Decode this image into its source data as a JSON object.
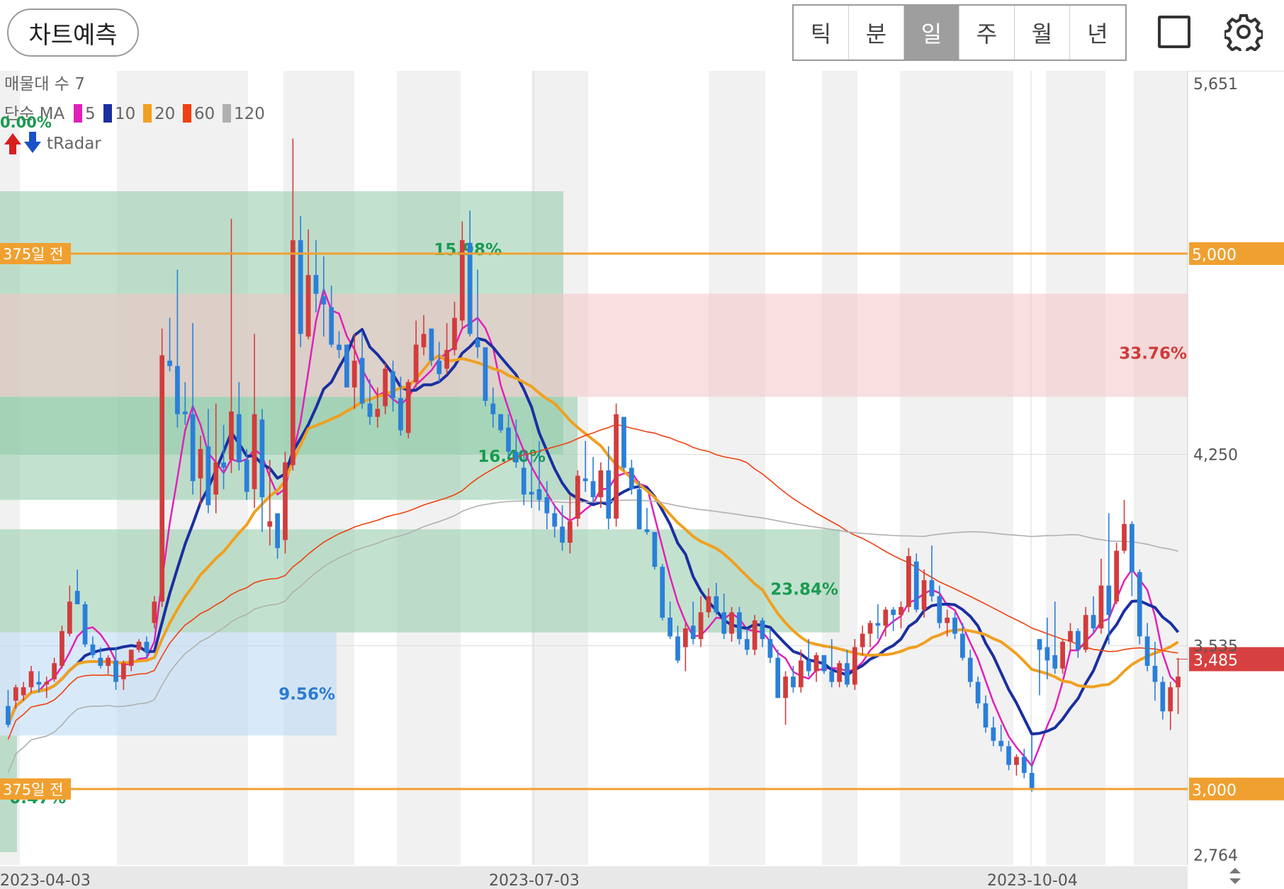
{
  "header": {
    "predict_label": "차트예측",
    "periods": [
      {
        "label": "틱",
        "active": false
      },
      {
        "label": "분",
        "active": false
      },
      {
        "label": "일",
        "active": true
      },
      {
        "label": "주",
        "active": false
      },
      {
        "label": "월",
        "active": false
      },
      {
        "label": "년",
        "active": false
      }
    ],
    "layout_icon": "single-panel-icon",
    "settings_icon": "gear-icon"
  },
  "legend": {
    "volume_profile": "매물대 수 7",
    "ma_prefix": "단순 MA",
    "ma": [
      {
        "label": "5",
        "color": "#e020b8"
      },
      {
        "label": "10",
        "color": "#1a2fa0"
      },
      {
        "label": "20",
        "color": "#f0a020"
      },
      {
        "label": "60",
        "color": "#f04010"
      },
      {
        "label": "120",
        "color": "#b0b0b0"
      }
    ],
    "radar": "tRadar",
    "radar_pct": "0.00%"
  },
  "chart_data": {
    "type": "candlestick",
    "y_range": [
      2764,
      5651
    ],
    "y_ticks": [
      "5,651",
      "4,250",
      "3,535",
      "2,764"
    ],
    "x_labels": [
      "2023-04-03",
      "2023-07-03",
      "2023-10-04"
    ],
    "ref_lines": [
      {
        "label": "375일 전",
        "value": 5000,
        "axis_label": "5,000",
        "color": "#f0a030"
      },
      {
        "label": "375일 전",
        "value": 3000,
        "axis_label": "3,000",
        "color": "#f0a030"
      }
    ],
    "current_price": {
      "value": 3485,
      "label": "3,485",
      "color": "#d64040"
    },
    "zones": [
      {
        "label": "15.98%",
        "from": 4250,
        "to": 5233,
        "color": "#8fcaa8",
        "label_color": "#1a9a50"
      },
      {
        "label": "33.76%",
        "from": 4465,
        "to": 4850,
        "color": "#f4c4c4",
        "label_color": "#d03a3a"
      },
      {
        "label": "16.40%",
        "from": 4080,
        "to": 4465,
        "color": "#8fcaa8",
        "label_color": "#1a9a50"
      },
      {
        "label": "23.84%",
        "from": 3585,
        "to": 3970,
        "color": "#8fcaa8",
        "label_color": "#1a9a50"
      },
      {
        "label": "9.56%",
        "from": 3200,
        "to": 3585,
        "color": "#b8d8f4",
        "label_color": "#2a7ad0"
      },
      {
        "label": "0.47%",
        "from": 2764,
        "to": 3200,
        "color": "#8fcaa8",
        "label_color": "#1a9a50"
      }
    ],
    "candles": [
      [
        3310,
        3370,
        3230,
        3240
      ],
      [
        3330,
        3390,
        3300,
        3380
      ],
      [
        3350,
        3400,
        3330,
        3380
      ],
      [
        3380,
        3460,
        3360,
        3440
      ],
      [
        3400,
        3440,
        3360,
        3390
      ],
      [
        3390,
        3420,
        3340,
        3400
      ],
      [
        3410,
        3490,
        3400,
        3470
      ],
      [
        3460,
        3610,
        3450,
        3590
      ],
      [
        3580,
        3760,
        3570,
        3700
      ],
      [
        3740,
        3820,
        3690,
        3690
      ],
      [
        3690,
        3700,
        3530,
        3540
      ],
      [
        3540,
        3570,
        3490,
        3500
      ],
      [
        3490,
        3530,
        3450,
        3460
      ],
      [
        3460,
        3500,
        3430,
        3490
      ],
      [
        3480,
        3530,
        3370,
        3400
      ],
      [
        3410,
        3480,
        3370,
        3470
      ],
      [
        3460,
        3520,
        3440,
        3520
      ],
      [
        3520,
        3560,
        3510,
        3550
      ],
      [
        3550,
        3570,
        3490,
        3510
      ],
      [
        3620,
        3720,
        3600,
        3700
      ],
      [
        3700,
        4720,
        3680,
        4620
      ],
      [
        4600,
        4760,
        4560,
        4580
      ],
      [
        4580,
        4940,
        4350,
        4400
      ],
      [
        4410,
        4520,
        4360,
        4400
      ],
      [
        4400,
        4740,
        4100,
        4150
      ],
      [
        4160,
        4320,
        4060,
        4270
      ],
      [
        4280,
        4420,
        4030,
        4060
      ],
      [
        4100,
        4440,
        4030,
        4220
      ],
      [
        4220,
        4360,
        4120,
        4200
      ],
      [
        4230,
        5130,
        4180,
        4410
      ],
      [
        4400,
        4520,
        4190,
        4220
      ],
      [
        4230,
        4270,
        4080,
        4110
      ],
      [
        4120,
        4700,
        4050,
        4400
      ],
      [
        4380,
        4420,
        3960,
        4090
      ],
      [
        3980,
        4230,
        3910,
        4000
      ],
      [
        4030,
        4020,
        3860,
        3900
      ],
      [
        3930,
        4260,
        3880,
        4220
      ],
      [
        4210,
        5430,
        4190,
        5050
      ],
      [
        5050,
        5140,
        4650,
        4700
      ],
      [
        4690,
        5090,
        4680,
        4920
      ],
      [
        4920,
        5050,
        4780,
        4850
      ],
      [
        4840,
        4990,
        4690,
        4810
      ],
      [
        4800,
        4880,
        4650,
        4660
      ],
      [
        4660,
        4710,
        4610,
        4640
      ],
      [
        4660,
        4650,
        4500,
        4500
      ],
      [
        4500,
        4700,
        4420,
        4600
      ],
      [
        4610,
        4710,
        4420,
        4440
      ],
      [
        4440,
        4530,
        4360,
        4390
      ],
      [
        4390,
        4500,
        4350,
        4420
      ],
      [
        4430,
        4590,
        4400,
        4570
      ],
      [
        4560,
        4600,
        4410,
        4460
      ],
      [
        4460,
        4540,
        4320,
        4340
      ],
      [
        4330,
        4530,
        4310,
        4520
      ],
      [
        4520,
        4750,
        4500,
        4660
      ],
      [
        4650,
        4770,
        4620,
        4700
      ],
      [
        4720,
        4690,
        4580,
        4600
      ],
      [
        4600,
        4670,
        4520,
        4550
      ],
      [
        4570,
        4740,
        4550,
        4640
      ],
      [
        4640,
        4820,
        4620,
        4760
      ],
      [
        4750,
        5120,
        4720,
        5050
      ],
      [
        5040,
        5160,
        4690,
        4700
      ],
      [
        4680,
        4940,
        4610,
        4650
      ],
      [
        4650,
        4580,
        4430,
        4450
      ],
      [
        4440,
        4500,
        4350,
        4400
      ],
      [
        4400,
        4370,
        4330,
        4340
      ],
      [
        4350,
        4400,
        4240,
        4260
      ],
      [
        4260,
        4380,
        4200,
        4220
      ],
      [
        4200,
        4260,
        4060,
        4100
      ],
      [
        4110,
        4250,
        4050,
        4100
      ],
      [
        4120,
        4300,
        4040,
        4080
      ],
      [
        4090,
        4150,
        3970,
        4030
      ],
      [
        4030,
        4060,
        3940,
        3980
      ],
      [
        3980,
        4060,
        3890,
        3920
      ],
      [
        3920,
        4100,
        3880,
        4000
      ],
      [
        4010,
        4190,
        3980,
        4170
      ],
      [
        4160,
        4300,
        4110,
        4150
      ],
      [
        4150,
        4240,
        4070,
        4090
      ],
      [
        4090,
        4220,
        4050,
        4190
      ],
      [
        4190,
        4280,
        3970,
        4010
      ],
      [
        4010,
        4440,
        3980,
        4400
      ],
      [
        4390,
        4330,
        4190,
        4200
      ],
      [
        4200,
        4230,
        4100,
        4120
      ],
      [
        4120,
        4150,
        3970,
        3970
      ],
      [
        3970,
        4050,
        3950,
        3960
      ],
      [
        3960,
        3900,
        3820,
        3830
      ],
      [
        3830,
        3840,
        3630,
        3640
      ],
      [
        3640,
        3700,
        3560,
        3570
      ],
      [
        3570,
        3610,
        3470,
        3480
      ],
      [
        3530,
        3620,
        3440,
        3600
      ],
      [
        3610,
        3700,
        3540,
        3560
      ],
      [
        3560,
        3720,
        3530,
        3660
      ],
      [
        3660,
        3750,
        3640,
        3720
      ],
      [
        3720,
        3770,
        3650,
        3660
      ],
      [
        3660,
        3730,
        3560,
        3580
      ],
      [
        3580,
        3680,
        3550,
        3660
      ],
      [
        3660,
        3680,
        3540,
        3560
      ],
      [
        3560,
        3600,
        3500,
        3520
      ],
      [
        3520,
        3650,
        3500,
        3630
      ],
      [
        3630,
        3640,
        3530,
        3560
      ],
      [
        3560,
        3600,
        3470,
        3490
      ],
      [
        3490,
        3520,
        3340,
        3340
      ],
      [
        3340,
        3440,
        3240,
        3420
      ],
      [
        3420,
        3460,
        3360,
        3380
      ],
      [
        3380,
        3520,
        3360,
        3480
      ],
      [
        3480,
        3560,
        3420,
        3440
      ],
      [
        3440,
        3510,
        3400,
        3500
      ],
      [
        3500,
        3490,
        3430,
        3440
      ],
      [
        3440,
        3560,
        3380,
        3400
      ],
      [
        3400,
        3480,
        3380,
        3470
      ],
      [
        3470,
        3520,
        3380,
        3390
      ],
      [
        3390,
        3560,
        3370,
        3530
      ],
      [
        3530,
        3610,
        3500,
        3580
      ],
      [
        3580,
        3630,
        3530,
        3620
      ],
      [
        3620,
        3690,
        3560,
        3610
      ],
      [
        3610,
        3680,
        3570,
        3670
      ],
      [
        3670,
        3680,
        3590,
        3650
      ],
      [
        3650,
        3700,
        3600,
        3680
      ],
      [
        3680,
        3900,
        3660,
        3870
      ],
      [
        3850,
        3880,
        3660,
        3670
      ],
      [
        3670,
        3820,
        3640,
        3780
      ],
      [
        3780,
        3910,
        3700,
        3720
      ],
      [
        3720,
        3760,
        3600,
        3620
      ],
      [
        3620,
        3670,
        3570,
        3640
      ],
      [
        3640,
        3660,
        3560,
        3580
      ],
      [
        3580,
        3620,
        3480,
        3490
      ],
      [
        3490,
        3520,
        3380,
        3400
      ],
      [
        3400,
        3420,
        3300,
        3320
      ],
      [
        3320,
        3350,
        3210,
        3230
      ],
      [
        3230,
        3270,
        3160,
        3180
      ],
      [
        3180,
        3240,
        3140,
        3160
      ],
      [
        3160,
        3180,
        3070,
        3090
      ],
      [
        3090,
        3130,
        3050,
        3120
      ],
      [
        3120,
        3150,
        3040,
        3060
      ],
      [
        3060,
        3200,
        2990,
        3000
      ],
      [
        3560,
        3530,
        3350,
        3520
      ],
      [
        3530,
        3640,
        3410,
        3480
      ],
      [
        3500,
        3700,
        3430,
        3450
      ],
      [
        3450,
        3560,
        3430,
        3550
      ],
      [
        3550,
        3620,
        3520,
        3590
      ],
      [
        3590,
        3600,
        3490,
        3520
      ],
      [
        3520,
        3680,
        3510,
        3650
      ],
      [
        3650,
        3720,
        3580,
        3600
      ],
      [
        3600,
        3860,
        3580,
        3760
      ],
      [
        3760,
        4030,
        3540,
        3650
      ],
      [
        3700,
        3920,
        3690,
        3890
      ],
      [
        3890,
        4080,
        3880,
        3990
      ],
      [
        3990,
        4000,
        3720,
        3810
      ],
      [
        3810,
        3820,
        3540,
        3570
      ],
      [
        3570,
        3620,
        3440,
        3460
      ],
      [
        3460,
        3550,
        3330,
        3400
      ],
      [
        3400,
        3420,
        3260,
        3290
      ],
      [
        3290,
        3400,
        3220,
        3380
      ],
      [
        3380,
        3490,
        3280,
        3420
      ]
    ]
  }
}
